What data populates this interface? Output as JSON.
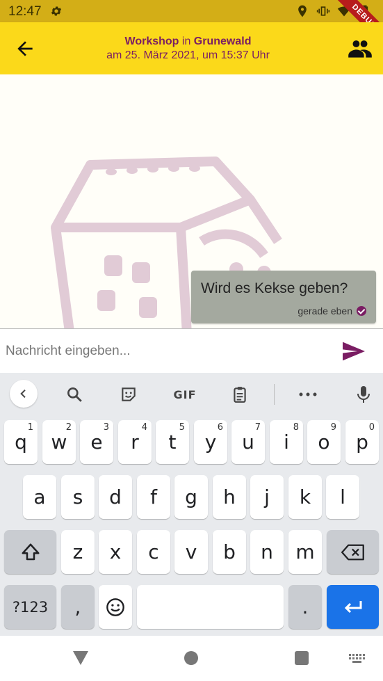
{
  "status_bar": {
    "time": "12:47",
    "debug_label": "DEBUG",
    "icons": [
      "gear-icon",
      "location-icon",
      "vibrate-icon",
      "wifi-icon",
      "battery-icon"
    ],
    "color": "#d3ae17"
  },
  "app_bar": {
    "title_event": "Workshop",
    "title_in": "in",
    "title_place": "Grunewald",
    "subtitle": "am 25. März 2021, um 15:37 Uhr",
    "color": "#fbd91a",
    "accent": "#7a1d63"
  },
  "chat": {
    "messages": [
      {
        "text": "Wird es Kekse geben?",
        "meta": "gerade eben",
        "status": "sent"
      }
    ]
  },
  "composer": {
    "placeholder": "Nachricht eingeben...",
    "value": ""
  },
  "keyboard": {
    "toolbar": {
      "gif_label": "GIF"
    },
    "row1": [
      {
        "k": "q",
        "s": "1"
      },
      {
        "k": "w",
        "s": "2"
      },
      {
        "k": "e",
        "s": "3"
      },
      {
        "k": "r",
        "s": "4"
      },
      {
        "k": "t",
        "s": "5"
      },
      {
        "k": "y",
        "s": "6"
      },
      {
        "k": "u",
        "s": "7"
      },
      {
        "k": "i",
        "s": "8"
      },
      {
        "k": "o",
        "s": "9"
      },
      {
        "k": "p",
        "s": "0"
      }
    ],
    "row2": [
      "a",
      "s",
      "d",
      "f",
      "g",
      "h",
      "j",
      "k",
      "l"
    ],
    "row3": [
      "z",
      "x",
      "c",
      "v",
      "b",
      "n",
      "m"
    ],
    "symbols_label": "?123",
    "comma": ",",
    "period": "."
  }
}
